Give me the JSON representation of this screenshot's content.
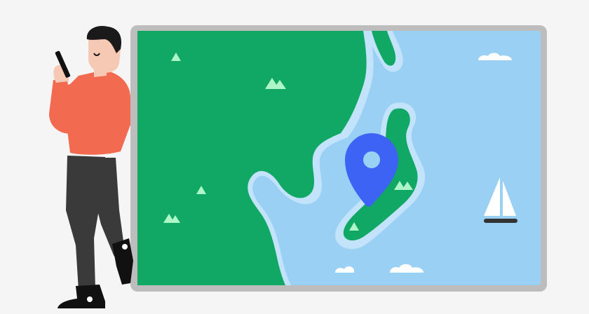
{
  "illustration": {
    "subject": "person-leaning-on-map-with-location-pin",
    "colors": {
      "background": "#f5f5f5",
      "frame": "#bdbdbd",
      "land": "#10a864",
      "water": "#9bd0f5",
      "shore": "#c2e3fa",
      "pin": "#3d63f5",
      "pin_hole": "#9bd0f5",
      "tree": "#aef5c8",
      "cloud": "#ffffff",
      "sail": "#ffffff",
      "boat_hull": "#333333",
      "shirt": "#f26a4f",
      "pants": "#3a3a3a",
      "skin": "#f6c9b5",
      "hair": "#1a1a1a",
      "shoe": "#111111"
    },
    "icons": [
      "location-pin-icon",
      "sailboat-icon",
      "cloud-icon",
      "tree-icon",
      "phone-icon"
    ]
  }
}
